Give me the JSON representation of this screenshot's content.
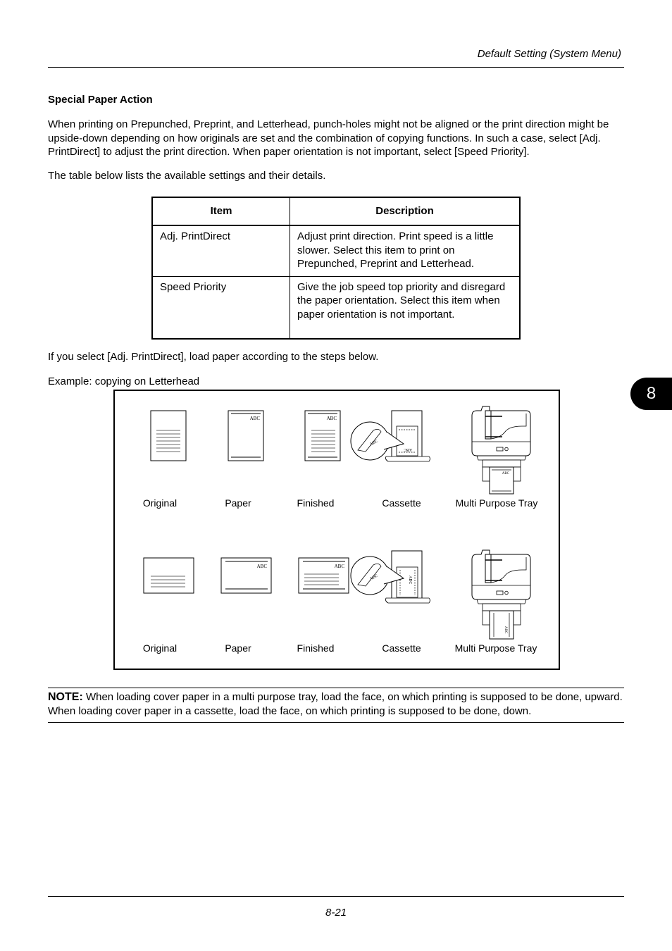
{
  "header": {
    "title": "Default Setting (System Menu)"
  },
  "section": {
    "title": "Special Paper Action",
    "intro": "When printing on Prepunched, Preprint, and Letterhead, punch-holes might not be aligned or the print direction might be upside-down depending on how originals are set and the combination of copying functions. In such a case, select [Adj. PrintDirect] to adjust the print direction. When paper orientation is not important, select [Speed Priority].",
    "table_intro": "The table below lists the available settings and their details."
  },
  "table": {
    "headers": [
      "Item",
      "Description"
    ],
    "rows": [
      {
        "item": "Adj. PrintDirect",
        "description": "Adjust print direction. Print speed is a little slower. Select this item to print on Prepunched, Preprint and Letterhead."
      },
      {
        "item": "Speed Priority",
        "description": "Give the job speed top priority and disregard the paper orientation. Select this item when paper orientation is not important."
      }
    ]
  },
  "after_table": "If you select [Adj. PrintDirect], load paper according to the steps below.",
  "example_label": "Example: copying on Letterhead",
  "figure": {
    "rows": [
      {
        "orientation": "portrait",
        "labels": [
          "Original",
          "Paper",
          "Finished",
          "Cassette",
          "Multi Purpose Tray"
        ]
      },
      {
        "orientation": "landscape",
        "labels": [
          "Original",
          "Paper",
          "Finished",
          "Cassette",
          "Multi Purpose Tray"
        ]
      }
    ],
    "letterhead_text": "ABC"
  },
  "note": {
    "label": "NOTE:",
    "text": " When loading cover paper in a multi purpose tray, load the face, on which printing is supposed to be done, upward. When loading cover paper in a cassette, load  the face, on which printing is supposed to be done, down."
  },
  "footer": {
    "page_number": "8-21"
  },
  "chapter_tab": {
    "number": "8"
  }
}
